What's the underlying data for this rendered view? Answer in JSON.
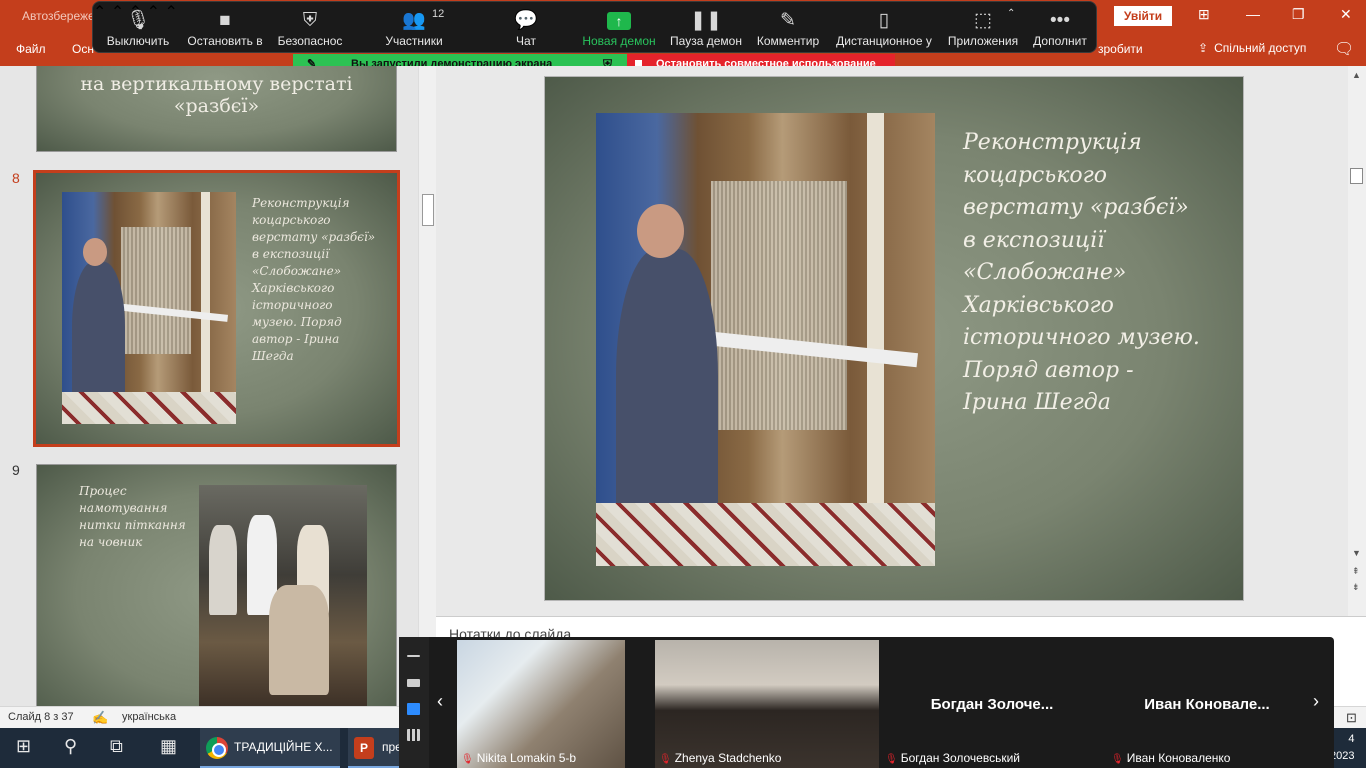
{
  "titlebar": {
    "autosave": "Автозбереже",
    "login": "Увійти"
  },
  "ribbon": {
    "file": "Файл",
    "tab2": "Осн",
    "hint": "зробити",
    "share": "Спільний доступ"
  },
  "zoom": {
    "mute": "Выключить",
    "video": "Остановить в",
    "security": "Безопаснос",
    "participants": "Участники",
    "participants_count": "12",
    "chat": "Чат",
    "new_share": "Новая демон",
    "pause_share": "Пауза демон",
    "annotate": "Комментир",
    "remote": "Дистанционное у",
    "apps": "Приложения",
    "more": "Дополнит",
    "sharing_notice": "Вы запустили демонстрацию экрана",
    "stop_share": "Остановить совместное использование"
  },
  "thumbs": {
    "slide7_title": "на  вертикальному верстаті «разбєї»",
    "slide8_num": "8",
    "slide8_text": "Реконструкція коцарського верстату «разбєї» в експозиції «Слобожане» Харківського історичного музею. Поряд автор  - Ірина Шегда",
    "slide9_num": "9",
    "slide9_text": "Процес намотування нитки піткання на човник"
  },
  "main_slide": {
    "line1": "Реконструкція",
    "line2": "коцарського",
    "line3": "верстату «разбєї»",
    "line4": "в експозиції",
    "line5": "«Слобожане»",
    "line6": "Харківського",
    "line7": "історичного музею.",
    "line8": "Поряд автор  -",
    "line9": "Ірина Шегда"
  },
  "notes": {
    "placeholder": "Нотатки до слайда"
  },
  "status": {
    "slide_count": "Слайд 8 з 37",
    "language": "українська"
  },
  "taskbar": {
    "chrome_label": "ТРАДИЦІЙНЕ Х...",
    "ppt_label": "пре",
    "clock_top": "4",
    "clock_bottom": "2023"
  },
  "gallery": {
    "p1": "Nikita Lomakin 5-b",
    "p2": "Zhenya Stadchenko",
    "p3_big": "Богдан  Золоче...",
    "p3": "Богдан Золочевський",
    "p4_big": "Иван  Коновале...",
    "p4": "Иван Коноваленко"
  }
}
